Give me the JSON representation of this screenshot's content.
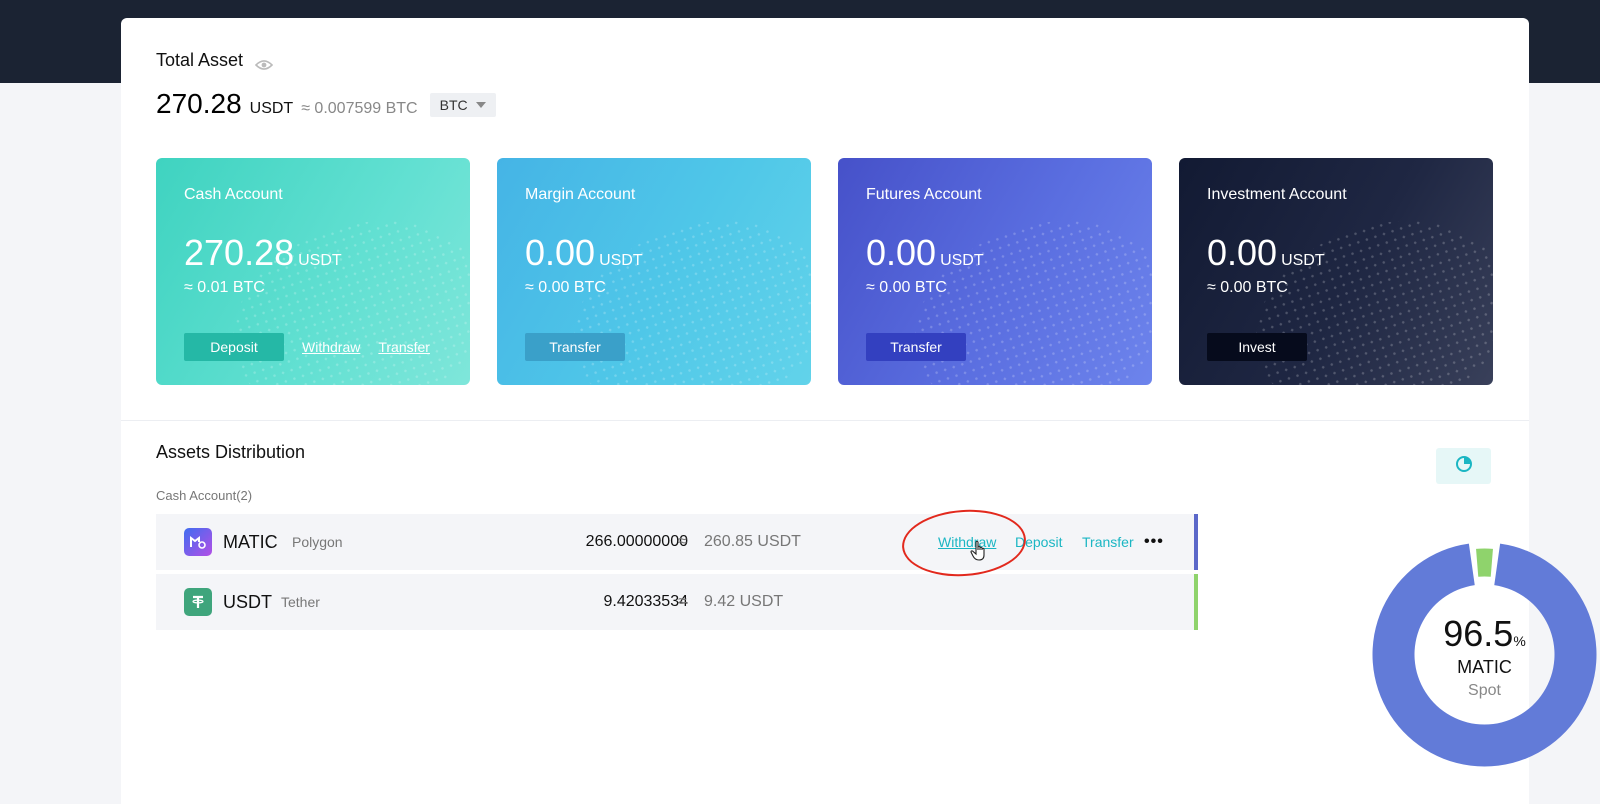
{
  "total_asset": {
    "title": "Total Asset",
    "amount": "270.28",
    "unit": "USDT",
    "approx_btc": "≈ 0.007599 BTC",
    "currency_select": "BTC"
  },
  "cards": [
    {
      "title": "Cash Account",
      "amount": "270.28",
      "unit": "USDT",
      "btc": "≈ 0.01 BTC",
      "button": "Deposit",
      "link1": "Withdraw",
      "link2": "Transfer"
    },
    {
      "title": "Margin Account",
      "amount": "0.00",
      "unit": "USDT",
      "btc": "≈ 0.00 BTC",
      "button": "Transfer"
    },
    {
      "title": "Futures Account",
      "amount": "0.00",
      "unit": "USDT",
      "btc": "≈ 0.00 BTC",
      "button": "Transfer"
    },
    {
      "title": "Investment Account",
      "amount": "0.00",
      "unit": "USDT",
      "btc": "≈ 0.00 BTC",
      "button": "Invest"
    }
  ],
  "distribution": {
    "title": "Assets Distribution",
    "subtitle": "Cash Account(2)",
    "rows": [
      {
        "symbol": "MATIC",
        "name": "Polygon",
        "amount": "266.00000000",
        "approx": "≈",
        "value": "260.85 USDT",
        "actions": [
          "Withdraw",
          "Deposit",
          "Transfer"
        ],
        "more": "•••",
        "bar_color": "#5b68c9"
      },
      {
        "symbol": "USDT",
        "name": "Tether",
        "amount": "9.42033534",
        "approx": "≈",
        "value": "9.42 USDT",
        "bar_color": "#8fd36c"
      }
    ]
  },
  "donut": {
    "percent": "96.5",
    "percent_sign": "%",
    "coin": "MATIC",
    "label": "Spot",
    "segments": [
      {
        "name": "MATIC",
        "fraction": 0.965,
        "color": "#627bd8"
      },
      {
        "name": "USDT",
        "fraction": 0.035,
        "color": "#8fd36c"
      }
    ]
  },
  "icons": {
    "eye": "eye-icon",
    "caret": "caret-down-icon",
    "chart": "pie-chart-icon",
    "matic": "matic-logo-icon",
    "usdt": "tether-logo-icon",
    "cursor": "hand-cursor-icon"
  }
}
